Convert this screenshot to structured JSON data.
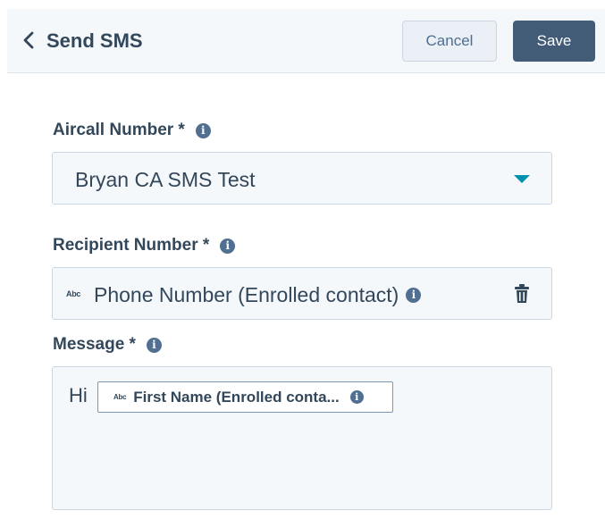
{
  "header": {
    "title": "Send SMS",
    "cancel_label": "Cancel",
    "save_label": "Save"
  },
  "aircall_number": {
    "label": "Aircall Number *",
    "value": "Bryan CA SMS Test"
  },
  "recipient_number": {
    "label": "Recipient Number *",
    "type_badge": "Abc",
    "value": "Phone Number (Enrolled contact)"
  },
  "message": {
    "label": "Message *",
    "text": "Hi",
    "token": {
      "type_badge": "Abc",
      "label": "First Name (Enrolled conta..."
    }
  },
  "colors": {
    "header_bg": "#f5f8fa",
    "save_bg": "#425b76",
    "caret": "#0091ae",
    "text": "#33475b"
  }
}
